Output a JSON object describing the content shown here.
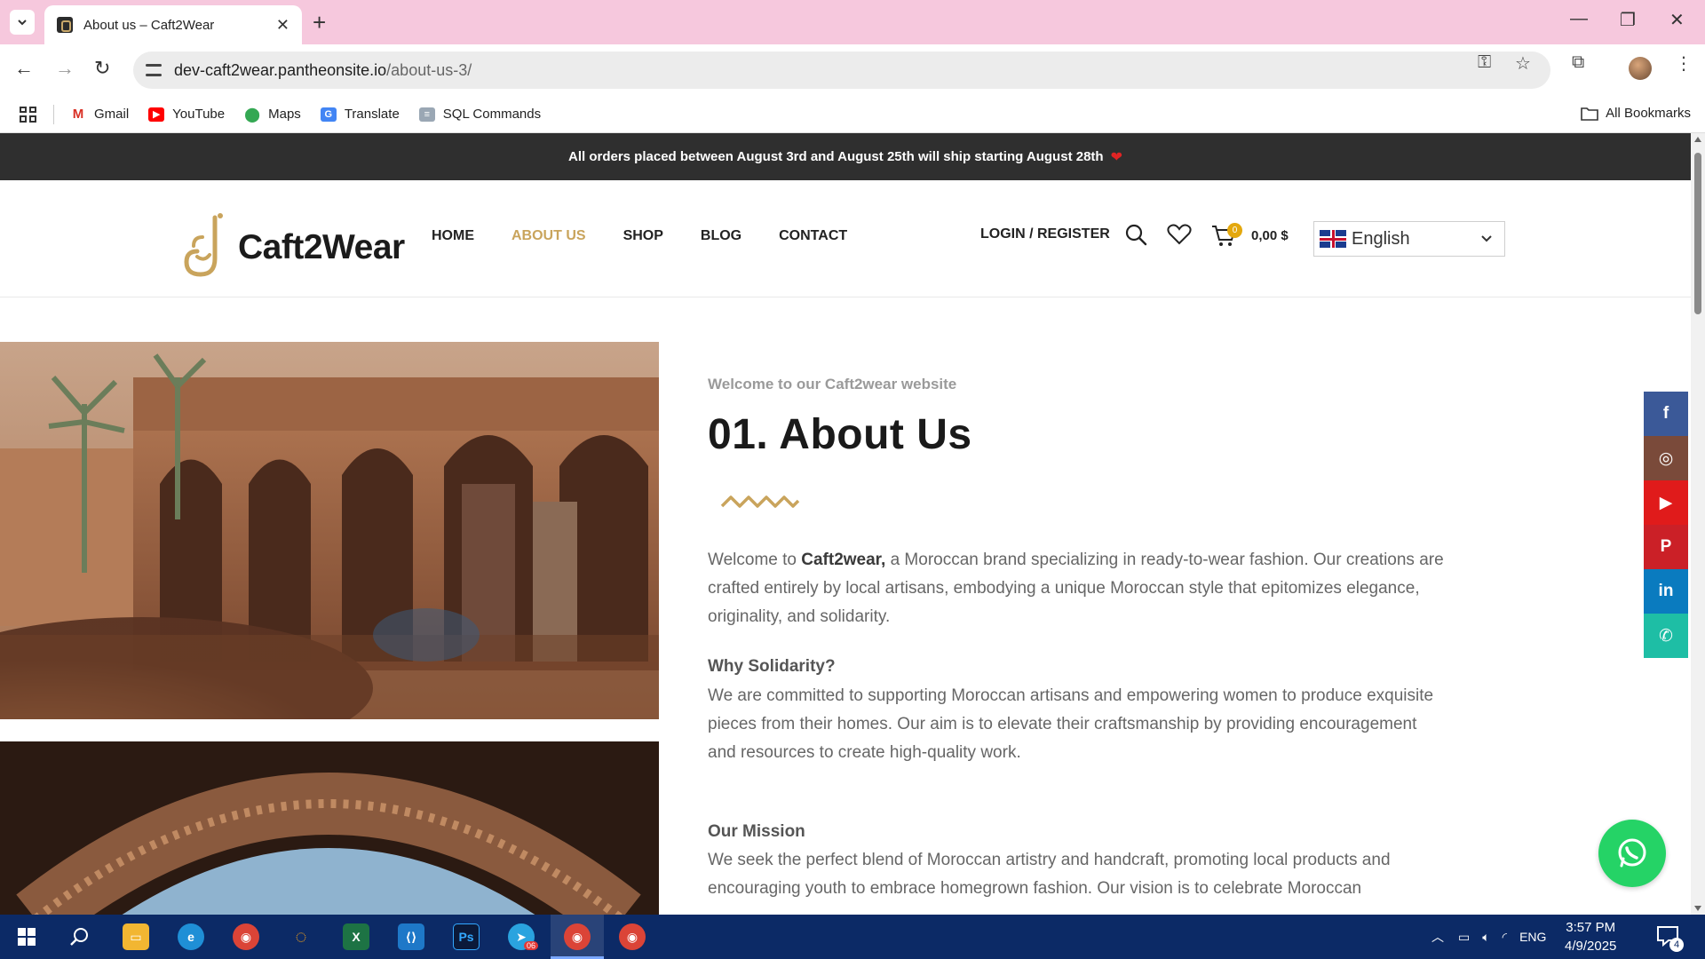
{
  "browser": {
    "tab_title": "About us – Caft2Wear",
    "url_host": "dev-caft2wear.pantheonsite.io",
    "url_path": "/about-us-3/",
    "bookmarks": [
      "Gmail",
      "YouTube",
      "Maps",
      "Translate",
      "SQL Commands"
    ],
    "all_bookmarks": "All Bookmarks"
  },
  "site": {
    "promo_text": "All orders placed between August 3rd and August 25th will ship starting August 28th",
    "logo_text": "Caft2Wear",
    "menu": [
      "HOME",
      "ABOUT US",
      "SHOP",
      "BLOG",
      "CONTACT"
    ],
    "active_menu": "ABOUT US",
    "login_label": "LOGIN / REGISTER",
    "cart_count": "0",
    "cart_total": "0,00 $",
    "language": "English",
    "brand_accent": "#c9a45c"
  },
  "about": {
    "kicker": "Welcome to our Caft2wear website",
    "title": "01. About Us",
    "intro_lead": "Welcome to ",
    "intro_brand": "Caft2wear,",
    "intro_rest": " a Moroccan brand specializing in ready-to-wear fashion. Our creations are crafted entirely by local artisans, embodying a unique Moroccan style that epitomizes elegance, originality, and solidarity.",
    "why_heading": "Why Solidarity?",
    "why_text": "We are committed to supporting Moroccan artisans and empowering women to produce exquisite pieces from their homes. Our aim is to elevate their craftsmanship by providing encouragement and resources to create high-quality work.",
    "mission_heading": "Our Mission",
    "mission_text": "We seek the perfect blend of Moroccan artistry and handcraft, promoting local products and encouraging youth to embrace homegrown fashion. Our vision is to celebrate Moroccan"
  },
  "social": {
    "icons": [
      "facebook-icon",
      "instagram-icon",
      "youtube-icon",
      "pinterest-icon",
      "linkedin-icon",
      "whatsapp-icon"
    ],
    "labels": [
      "f",
      "◎",
      "▶",
      "P",
      "in",
      "✆"
    ],
    "colors": [
      "#3b5998",
      "#7a4a3a",
      "#e01b1b",
      "#cb2027",
      "#0a7bbf",
      "#1ebea5"
    ]
  },
  "taskbar": {
    "language": "ENG",
    "time": "3:57 PM",
    "date": "4/9/2025",
    "notifications": "4",
    "telegram_badge": "06"
  }
}
